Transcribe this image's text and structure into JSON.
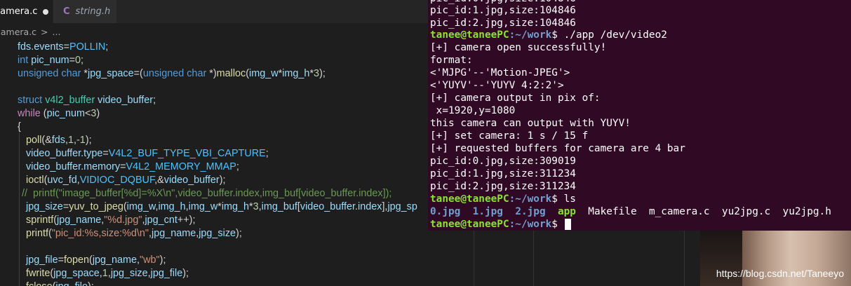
{
  "editor": {
    "tabs": [
      {
        "label": "camera.c",
        "modified": true
      },
      {
        "label": "string.h"
      }
    ],
    "breadcrumb": {
      "file": "camera.c",
      "sep": ">",
      "more": "..."
    }
  },
  "terminal": {
    "lines": [
      "pic_id:1.jpg,size:104846",
      "pic_id:2.jpg,size:104846",
      "[+] camera open successfully!",
      "format:",
      "<'MJPG'--'Motion-JPEG'>",
      "<'YUYV'--'YUYV 4:2:2'>",
      "[+] camera output in pix of:",
      " x=1920,y=1080",
      "this camera can output with YUYV!",
      "[+] set camera: 1 s / 15 f",
      "[+] requested buffers for camera are 4 bar",
      "pic_id:0.jpg,size:309019",
      "pic_id:1.jpg,size:311234",
      "pic_id:2.jpg,size:311234"
    ],
    "prompt_user": "tanee@taneePC",
    "prompt_path": ":~/work",
    "prompt_symbol": "$",
    "command1": " ./app /dev/video2",
    "command2": " ls",
    "ls_output": [
      "0.jpg",
      "1.jpg",
      "2.jpg",
      "app",
      "Makefile",
      "m_camera.c",
      "yu2jpg.c",
      "yu2jpg.h"
    ]
  },
  "watermark": "https://blog.csdn.net/Taneeyo",
  "colors": {
    "terminal_bg": "#300a24",
    "editor_bg": "#1e1e1e",
    "prompt_green": "#8ae234",
    "prompt_blue": "#729fcf"
  }
}
